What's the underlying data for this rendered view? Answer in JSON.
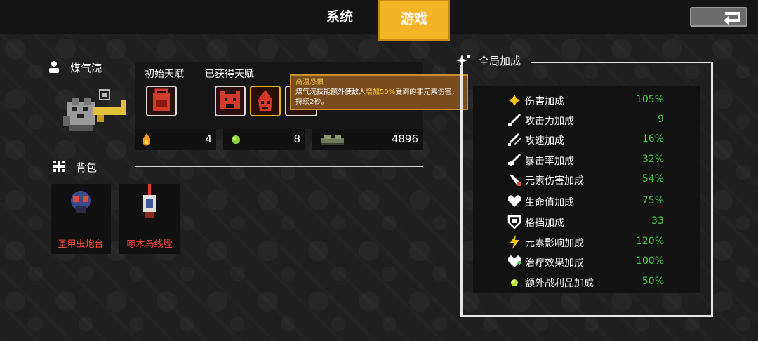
{
  "tabs": {
    "system": "系统",
    "game": "游戏"
  },
  "hero": {
    "name": "煤气涜"
  },
  "talents": {
    "initial_label": "初始天赋",
    "obtained_label": "已获得天赋",
    "tooltip": {
      "title": "高温恐惧",
      "body_before": "煤气涜技能额外使敌人",
      "body_highlight": "增加50%",
      "body_after": "受到的非元素伤害，持续2秒。"
    }
  },
  "resources": [
    {
      "icon": "flame-icon",
      "value": "4"
    },
    {
      "icon": "green-gem-icon",
      "value": "8"
    },
    {
      "icon": "ammo-icon",
      "value": "4896"
    }
  ],
  "backpack": {
    "title": "背包",
    "items": [
      {
        "name": "圣甲虫炮台",
        "icon": "scarab-turret-icon"
      },
      {
        "name": "啄木鸟线膛",
        "icon": "woodpecker-rifle-icon"
      }
    ]
  },
  "global_bonus": {
    "title": "全局加成",
    "rows": [
      {
        "icon": "damage-icon",
        "label": "伤害加成",
        "value": "105%"
      },
      {
        "icon": "sword-icon",
        "label": "攻击力加成",
        "value": "9"
      },
      {
        "icon": "attack-speed-icon",
        "label": "攻速加成",
        "value": "16%"
      },
      {
        "icon": "crit-icon",
        "label": "暴击率加成",
        "value": "32%"
      },
      {
        "icon": "elemental-damage-icon",
        "label": "元素伤害加成",
        "value": "54%"
      },
      {
        "icon": "heart-icon",
        "label": "生命值加成",
        "value": "75%"
      },
      {
        "icon": "shield-icon",
        "label": "格挡加成",
        "value": "33"
      },
      {
        "icon": "lightning-icon",
        "label": "元素影响加成",
        "value": "120%"
      },
      {
        "icon": "heal-heart-icon",
        "label": "治疗效果加成",
        "value": "100%"
      },
      {
        "icon": "loot-orb-icon",
        "label": "额外战利品加成",
        "value": "50%"
      }
    ]
  },
  "colors": {
    "accent": "#f5b328",
    "positive": "#4ad04a",
    "item_name": "#ff4a3a",
    "tooltip_bg": "#7a4b1c"
  }
}
